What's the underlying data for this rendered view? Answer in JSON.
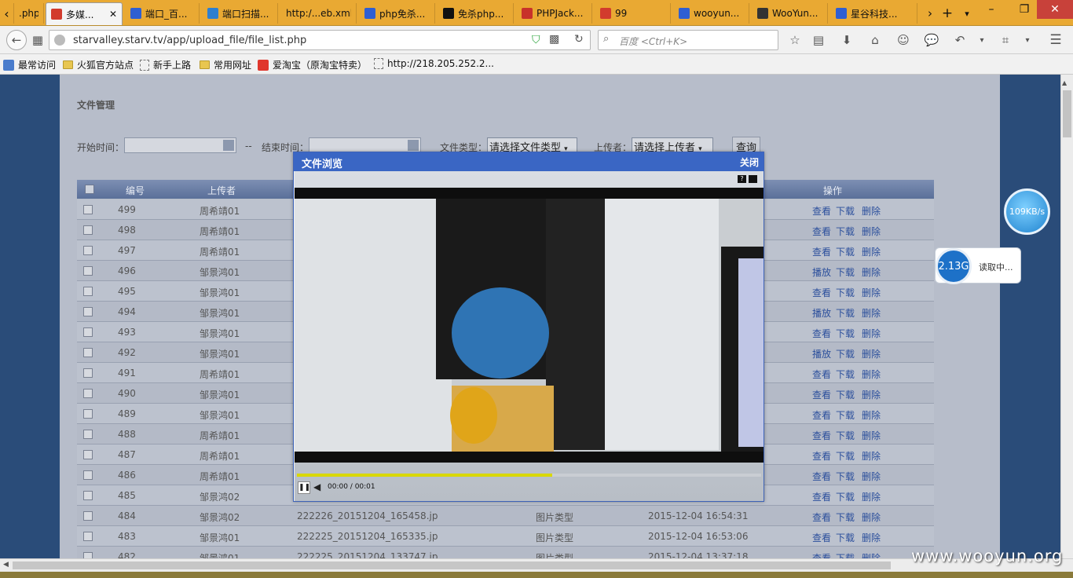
{
  "browser": {
    "tabs": [
      {
        "label": ".php",
        "icon": "page-icon",
        "color": "#e9a933"
      },
      {
        "label": "多媒...",
        "icon": "shield-icon",
        "color": "#d23b2d",
        "active": true
      },
      {
        "label": "端口_百...",
        "icon": "baidu-icon",
        "color": "#2f5fd2"
      },
      {
        "label": "端口扫描...",
        "icon": "bookmark-icon",
        "color": "#2d7fd0"
      },
      {
        "label": "http:/...eb.xml",
        "icon": "none",
        "color": "#e9a933"
      },
      {
        "label": "php免杀...",
        "icon": "baidu-icon",
        "color": "#2f5fd2"
      },
      {
        "label": "免杀php...",
        "icon": "bell-icon",
        "color": "#111111"
      },
      {
        "label": "PHPJack...",
        "icon": "p-icon",
        "color": "#c8322a"
      },
      {
        "label": "99",
        "icon": "shield-icon",
        "color": "#d23b2d"
      },
      {
        "label": "wooyun...",
        "icon": "baidu-icon",
        "color": "#2f5fd2"
      },
      {
        "label": "WooYun...",
        "icon": "wooyun-icon",
        "color": "#333333"
      },
      {
        "label": "星谷科技...",
        "icon": "baidu-icon",
        "color": "#2f5fd2"
      }
    ],
    "url": "starvalley.starv.tv/app/upload_file/file_list.php",
    "search_placeholder": "百度 <Ctrl+K>",
    "bookmarks": [
      "最常访问",
      "火狐官方站点",
      "新手上路",
      "常用网址",
      "爱淘宝（原淘宝特卖）",
      "http://218.205.252.2..."
    ]
  },
  "page": {
    "title": "文件管理",
    "filters": {
      "start_label": "开始时间：",
      "separator": "--",
      "end_label": "结束时间：",
      "type_label": "文件类型：",
      "type_value": "请选择文件类型",
      "uploader_label": "上传者：",
      "uploader_value": "请选择上传者",
      "query_button": "查询"
    },
    "columns": {
      "id": "编号",
      "uploader": "上传者",
      "actions": "操作"
    },
    "rows": [
      {
        "id": "499",
        "uploader": "周希靖01",
        "name": "",
        "type": "",
        "time": "",
        "op1": "查看"
      },
      {
        "id": "498",
        "uploader": "周希靖01",
        "name": "",
        "type": "",
        "time": "",
        "op1": "查看"
      },
      {
        "id": "497",
        "uploader": "周希靖01",
        "name": "",
        "type": "",
        "time": "",
        "op1": "查看"
      },
      {
        "id": "496",
        "uploader": "邹景鸿01",
        "name": "",
        "type": "",
        "time": "",
        "op1": "播放"
      },
      {
        "id": "495",
        "uploader": "邹景鸿01",
        "name": "",
        "type": "",
        "time": "",
        "op1": "查看"
      },
      {
        "id": "494",
        "uploader": "邹景鸿01",
        "name": "",
        "type": "",
        "time": "",
        "op1": "播放"
      },
      {
        "id": "493",
        "uploader": "邹景鸿01",
        "name": "",
        "type": "",
        "time": "",
        "op1": "查看"
      },
      {
        "id": "492",
        "uploader": "邹景鸿01",
        "name": "",
        "type": "",
        "time": "",
        "op1": "播放"
      },
      {
        "id": "491",
        "uploader": "周希靖01",
        "name": "",
        "type": "",
        "time": "",
        "op1": "查看"
      },
      {
        "id": "490",
        "uploader": "邹景鸿01",
        "name": "",
        "type": "",
        "time": "",
        "op1": "查看"
      },
      {
        "id": "489",
        "uploader": "邹景鸿01",
        "name": "",
        "type": "",
        "time": "",
        "op1": "查看"
      },
      {
        "id": "488",
        "uploader": "周希靖01",
        "name": "",
        "type": "",
        "time": "",
        "op1": "查看"
      },
      {
        "id": "487",
        "uploader": "周希靖01",
        "name": "",
        "type": "",
        "time": "",
        "op1": "查看"
      },
      {
        "id": "486",
        "uploader": "周希靖01",
        "name": "",
        "type": "",
        "time": "",
        "op1": "查看"
      },
      {
        "id": "485",
        "uploader": "邹景鸿02",
        "name": "",
        "type": "",
        "time": "",
        "op1": "查看"
      },
      {
        "id": "484",
        "uploader": "邹景鸿02",
        "name": "222226_20151204_165458.jp",
        "type": "图片类型",
        "time": "2015-12-04 16:54:31",
        "op1": "查看"
      },
      {
        "id": "483",
        "uploader": "邹景鸿01",
        "name": "222225_20151204_165335.jp",
        "type": "图片类型",
        "time": "2015-12-04 16:53:06",
        "op1": "查看"
      },
      {
        "id": "482",
        "uploader": "邹景鸿01",
        "name": "222225_20151204_133747.jp",
        "type": "图片类型",
        "time": "2015-12-04 13:37:18",
        "op1": "查看"
      }
    ],
    "op_download": "下载",
    "op_delete": "删除"
  },
  "modal": {
    "title": "文件浏览",
    "close": "关闭",
    "player_time": "00:00 / 00:01",
    "progress": 0.55
  },
  "widgets": {
    "speed": "109KB/s",
    "disk": "2.13G",
    "status": "读取中..."
  },
  "watermark": "www.wooyun.org"
}
